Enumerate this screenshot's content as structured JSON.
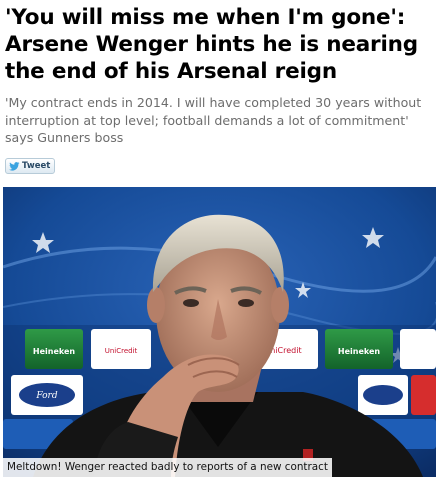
{
  "article": {
    "headline": "'You will miss me when I'm gone': Arsene Wenger hints he is nearing the end of his Arsenal reign",
    "standfirst": "'My contract ends in 2014. I will have completed 30 years without interruption at top level; football demands a lot of commitment' says Gunners boss"
  },
  "share": {
    "tweet_label": "Tweet",
    "icon": "twitter-bird-icon"
  },
  "photo": {
    "caption": "Meltdown! Wenger reacted badly to reports of a new contract",
    "backdrop_logos": [
      "Heineken",
      "UniCredit",
      "Ford"
    ]
  },
  "colors": {
    "headline": "#000000",
    "standfirst": "#6d6d6d",
    "backdrop_blue": "#0f3a7d",
    "heineken_green": "#1e7a34"
  }
}
